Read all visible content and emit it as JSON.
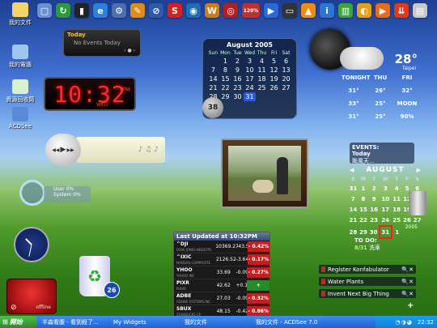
{
  "desktop_icons": [
    {
      "label": "我的文件",
      "icon": "documents-folder-icon",
      "color": "#f3d36b"
    },
    {
      "label": "我的電腦",
      "icon": "my-computer-icon",
      "color": "#9fc6ef"
    },
    {
      "label": "資源回收筒",
      "icon": "recycle-bin-icon",
      "color": "#d8f2d0"
    },
    {
      "label": "ACDSee",
      "icon": "acdsee-icon",
      "color": "#5b8bd8"
    }
  ],
  "toolbar": {
    "icons": [
      {
        "name": "desktop-icon",
        "glyph": "▢",
        "color": "#6b8fd3"
      },
      {
        "name": "refresh-icon",
        "glyph": "↻",
        "color": "#2a9a3a"
      },
      {
        "name": "clock-app-icon",
        "glyph": "▮",
        "color": "#222"
      },
      {
        "name": "ie-icon",
        "glyph": "e",
        "color": "#2d7fe0"
      },
      {
        "name": "settings-icon",
        "glyph": "⚙",
        "color": "#4c6fae"
      },
      {
        "name": "tools-icon",
        "glyph": "✎",
        "color": "#e08a1c"
      },
      {
        "name": "spyware-icon",
        "glyph": "⊘",
        "color": "#2e5aa8"
      },
      {
        "name": "s-app-icon",
        "glyph": "S",
        "color": "#d42020"
      },
      {
        "name": "globe-icon",
        "glyph": "◉",
        "color": "#1f6db8"
      },
      {
        "name": "winamp-icon",
        "glyph": "W",
        "color": "#d07a1a"
      },
      {
        "name": "media-icon",
        "glyph": "◎",
        "color": "#b02020"
      },
      {
        "name": "percent-icon",
        "glyph": "120%",
        "color": "#c03030"
      },
      {
        "name": "play-icon",
        "glyph": "▶",
        "color": "#2a6ad8"
      },
      {
        "name": "screen-icon",
        "glyph": "▭",
        "color": "#333"
      },
      {
        "name": "vlc-icon",
        "glyph": "▲",
        "color": "#f08a10"
      },
      {
        "name": "info-icon",
        "glyph": "i",
        "color": "#2a76d2"
      },
      {
        "name": "battery-icon",
        "glyph": "▥",
        "color": "#3aa63a"
      },
      {
        "name": "shell-icon",
        "glyph": "◐",
        "color": "#e4a010"
      },
      {
        "name": "forward-icon",
        "glyph": "▶",
        "color": "#e86a1a"
      },
      {
        "name": "down-arrow-icon",
        "glyph": "⇊",
        "color": "#e03a1a"
      },
      {
        "name": "notes-icon",
        "glyph": "▤",
        "color": "#c8c8c8"
      }
    ]
  },
  "events_widget": {
    "title": "Today",
    "message": "No Events Today"
  },
  "digital_clock": {
    "time": "10:32",
    "ampm": "PM",
    "day": "WED"
  },
  "calendar_widget": {
    "month": "August 2005",
    "days_header": [
      "Sun",
      "Mon",
      "Tue",
      "Wed",
      "Thu",
      "Fri",
      "Sat"
    ],
    "weeks": [
      [
        "",
        "1",
        "2",
        "3",
        "4",
        "5",
        "6"
      ],
      [
        "7",
        "8",
        "9",
        "10",
        "11",
        "12",
        "13"
      ],
      [
        "14",
        "15",
        "16",
        "17",
        "18",
        "19",
        "20"
      ],
      [
        "21",
        "22",
        "23",
        "24",
        "25",
        "26",
        "27"
      ],
      [
        "28",
        "29",
        "30",
        "31",
        "",
        "",
        ""
      ]
    ],
    "badge": "38"
  },
  "weather_widget": {
    "temp": "28°",
    "city": "Taipei",
    "today_label": "TONIGHT",
    "rows": [
      {
        "a": "TONIGHT",
        "b": "THU",
        "c": "FRI"
      },
      {
        "a": "31°",
        "b": "26°",
        "c": "32°"
      },
      {
        "a": "33°",
        "b": "25°",
        "c": "MOON"
      },
      {
        "a": "31°",
        "b": "25°",
        "c": "90%"
      }
    ],
    "moon_pct": "90%"
  },
  "media_widget": {
    "controls": [
      "◀◀",
      "▶",
      "▶▶"
    ],
    "title_text": "♪ ♫ ♪"
  },
  "cpu_widget": {
    "label1": "User 0%",
    "label2": "System 0%"
  },
  "photo_widget": {
    "caption": ""
  },
  "events_panel": {
    "title": "EVENTS:",
    "today": "Today",
    "text": "颱風天..."
  },
  "august_widget": {
    "month": "AUGUST",
    "days_header": [
      "S",
      "M",
      "T",
      "W",
      "T",
      "F",
      "S"
    ],
    "weeks": [
      [
        "31",
        "1",
        "2",
        "3",
        "4",
        "5",
        "6"
      ],
      [
        "7",
        "8",
        "9",
        "10",
        "11",
        "12",
        "13"
      ],
      [
        "14",
        "15",
        "16",
        "17",
        "18",
        "19",
        "20"
      ],
      [
        "21",
        "22",
        "23",
        "24",
        "25",
        "26",
        "27"
      ],
      [
        "28",
        "29",
        "30",
        "31",
        "1",
        "",
        ""
      ]
    ],
    "year": "2005",
    "highlight": "31"
  },
  "analog_clock": {
    "hour_angle": 315,
    "minute_angle": 192
  },
  "offline_widget": {
    "status": "offline"
  },
  "recycle_widget": {
    "count": "26"
  },
  "stocks_widget": {
    "header": "Last Updated at 10:32PM",
    "rows": [
      {
        "sym": "^DJI",
        "name": "DOW JONES INDUSTR",
        "price": "10369.27",
        "chg": "-43.55",
        "pct": "0.42%",
        "dir": "down"
      },
      {
        "sym": "^IXIC",
        "name": "NASDAQ COMPOSITE",
        "price": "2126.52",
        "chg": "-3.64",
        "pct": "0.17%",
        "dir": "down"
      },
      {
        "sym": "YHOO",
        "name": "YAHOO INC",
        "price": "33.69",
        "chg": "-0.09",
        "pct": "0.27%",
        "dir": "down"
      },
      {
        "sym": "PIXR",
        "name": "PIXAR",
        "price": "42.62",
        "chg": "+0.15",
        "pct": "0.35%",
        "dir": "up"
      },
      {
        "sym": "ADBE",
        "name": "ADOBE SYSTEMS INC",
        "price": "27.03",
        "chg": "-0.09",
        "pct": "0.32%",
        "dir": "down"
      },
      {
        "sym": "SBUX",
        "name": "STARBUCKS CP",
        "price": "48.15",
        "chg": "-0.42",
        "pct": "0.86%",
        "dir": "down"
      }
    ]
  },
  "todo_widget": {
    "title": "TO DO:",
    "sub": "8/31 洗車",
    "items": [
      "Register Konfabulator",
      "Water Plants",
      "Invent Next Big Thing"
    ],
    "add": "+"
  },
  "recycle_small": {
    "label": "2005"
  },
  "taskbar": {
    "start": "開始",
    "buttons": [
      "半森看腹 - 看到殺了...",
      "My Widgets",
      "我的文件",
      "我的文件 - ACDSee 7.0"
    ],
    "clock": "22:32"
  }
}
